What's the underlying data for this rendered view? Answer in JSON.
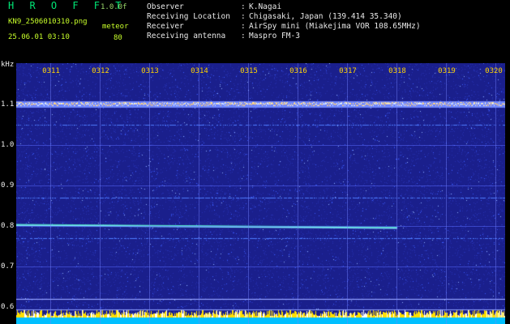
{
  "header": {
    "app_title": "H R O F F T",
    "version": "1.0.0f",
    "filename": "KN9_2506010310.png",
    "datetime": "25.06.01 03:10",
    "meteor_label": "meteor",
    "meteor_count": "80"
  },
  "station_info": [
    {
      "label": "Observer",
      "value": "K.Nagai"
    },
    {
      "label": "Receiving Location",
      "value": "Chigasaki, Japan (139.414 35.340)"
    },
    {
      "label": "Receiver",
      "value": "AirSpy mini (Miakejima VOR 108.65MHz)"
    },
    {
      "label": "Receiving antenna",
      "value": "Maspro FM-3"
    }
  ],
  "separator": ":",
  "axis": {
    "y_unit": "kHz",
    "y_ticks": [
      "1.1",
      "1.0",
      "0.9",
      "0.8",
      "0.7",
      "0.6"
    ],
    "x_ticks": [
      "0311",
      "0312",
      "0313",
      "0314",
      "0315",
      "0316",
      "0317",
      "0318",
      "0319",
      "0320"
    ]
  },
  "spectrogram": {
    "background_color": "#1a1f8c",
    "noise_color": "#3a5cff",
    "carrier_color": "#d8e8ff",
    "meteor_color": "#7fe3ff",
    "baseline_color": "#ffe000",
    "floor_color": "#00bfff",
    "carrier_khz": 1.1,
    "meteor_khz": 0.8
  }
}
